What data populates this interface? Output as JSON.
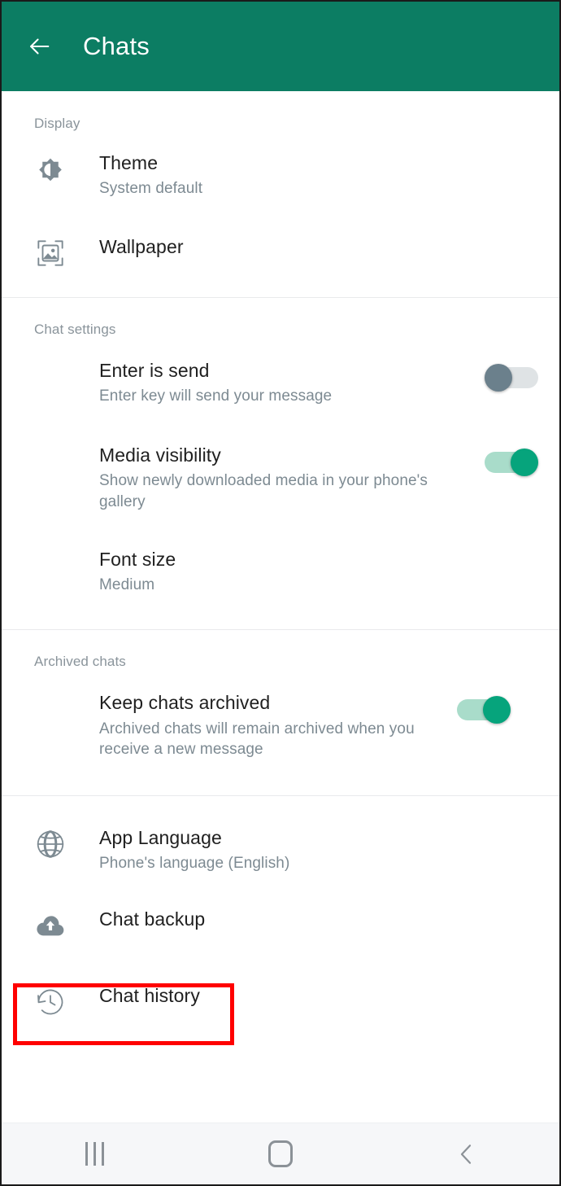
{
  "appbar": {
    "back_icon": "arrow-left-icon",
    "title": "Chats",
    "background_color": "#0C7D63",
    "text_color": "#FFFFFF"
  },
  "sections": [
    {
      "id": "display",
      "label": "Display",
      "rows": [
        {
          "id": "theme",
          "icon": "brightness-icon",
          "title": "Theme",
          "subtitle": "System default",
          "control": "none"
        },
        {
          "id": "wallpaper",
          "icon": "wallpaper-image-icon",
          "title": "Wallpaper",
          "subtitle": "",
          "control": "none"
        }
      ]
    },
    {
      "id": "chat-settings",
      "label": "Chat settings",
      "rows": [
        {
          "id": "enter-is-send",
          "icon": "",
          "title": "Enter is send",
          "subtitle": "Enter key will send your message",
          "control": "switch",
          "switch_state": "off"
        },
        {
          "id": "media-visibility",
          "icon": "",
          "title": "Media visibility",
          "subtitle": "Show newly downloaded media in your phone's gallery",
          "control": "switch",
          "switch_state": "on"
        },
        {
          "id": "font-size",
          "icon": "",
          "title": "Font size",
          "subtitle": "Medium",
          "control": "none"
        }
      ]
    },
    {
      "id": "archived-chats",
      "label": "Archived chats",
      "rows": [
        {
          "id": "keep-chats-archived",
          "icon": "",
          "title": "Keep chats archived",
          "subtitle": "Archived chats will remain archived when you receive a new message",
          "control": "switch",
          "switch_state": "on"
        }
      ]
    },
    {
      "id": "misc",
      "label": "",
      "rows": [
        {
          "id": "app-language",
          "icon": "globe-icon",
          "title": "App Language",
          "subtitle": "Phone's language (English)",
          "control": "none"
        },
        {
          "id": "chat-backup",
          "icon": "cloud-upload-icon",
          "title": "Chat backup",
          "subtitle": "",
          "control": "none"
        },
        {
          "id": "chat-history",
          "icon": "history-clock-icon",
          "title": "Chat history",
          "subtitle": "",
          "control": "none",
          "highlighted": true
        }
      ]
    }
  ],
  "highlight": {
    "target": "chat-history",
    "color": "#FF0000"
  },
  "navbar": {
    "recents_icon": "recents-bars-icon",
    "home_icon": "home-square-icon",
    "back_icon": "chevron-left-icon",
    "background_color": "#F6F7F9",
    "icon_color": "#8B9197"
  },
  "colors": {
    "accent_green": "#06A47C",
    "header_green": "#0C7D63",
    "switch_off_thumb": "#6B808C",
    "switch_off_track": "#DFE3E5",
    "switch_on_track": "#A9DCCA",
    "title_text": "#1F1F1F",
    "subtitle_text": "#7D8A92",
    "section_label": "#8A949B",
    "icon_gray": "#7D8A92"
  }
}
